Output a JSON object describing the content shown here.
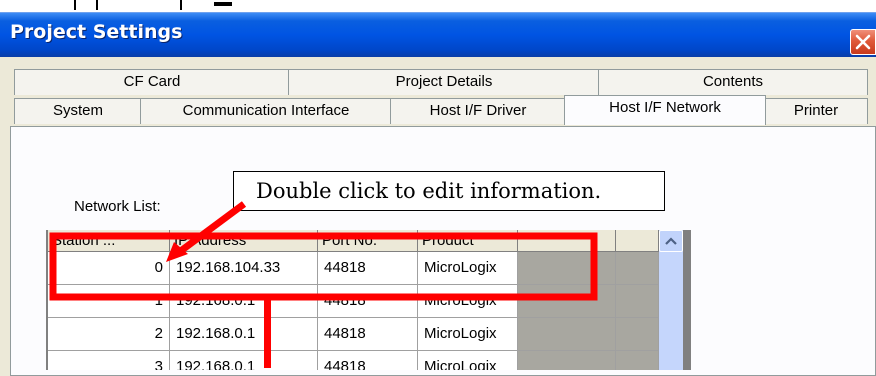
{
  "window": {
    "title": "Project Settings"
  },
  "tabs": {
    "row_back": [
      {
        "label": "CF Card"
      },
      {
        "label": "Project Details"
      },
      {
        "label": "Contents"
      }
    ],
    "row_front": [
      {
        "label": "System"
      },
      {
        "label": "Communication Interface"
      },
      {
        "label": "Host I/F Driver"
      },
      {
        "label": "Host I/F Network",
        "active": true
      },
      {
        "label": "Printer"
      }
    ]
  },
  "network": {
    "label": "Network List:",
    "columns": [
      "Station ...",
      "IP Address",
      "Port No.",
      "Product"
    ],
    "rows": [
      {
        "station": "0",
        "ip": "192.168.104.33",
        "port": "44818",
        "product": "MicroLogix"
      },
      {
        "station": "1",
        "ip": "192.168.0.1",
        "port": "44818",
        "product": "MicroLogix"
      },
      {
        "station": "2",
        "ip": "192.168.0.1",
        "port": "44818",
        "product": "MicroLogix"
      },
      {
        "station": "3",
        "ip": "192.168.0.1",
        "port": "44818",
        "product": "MicroLogix"
      }
    ]
  },
  "callout": {
    "text": "Double click to edit information."
  },
  "colors": {
    "titlebar": "#0054e3",
    "annotation_red": "#ff0000",
    "dialog_bg": "#ece9d8"
  },
  "icons": {
    "close": "close-icon",
    "scroll_up": "chevron-up-icon"
  }
}
